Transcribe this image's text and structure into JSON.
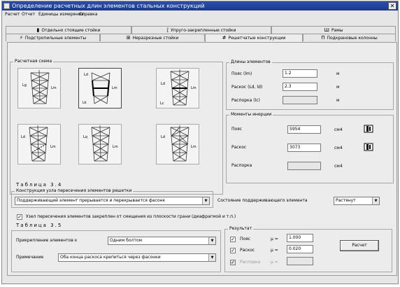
{
  "window": {
    "title": "Определение расчетных длин элементов стальных конструкций",
    "close_label": "✕"
  },
  "menu": [
    "Расчет",
    "Отчет",
    "Единицы измерения",
    "Справка"
  ],
  "tabs_row1": [
    {
      "label": "Отдельно стоящие стойки",
      "icon": "column-icon"
    },
    {
      "label": "Упруго-закрепленные стойки",
      "icon": "spring-icon"
    },
    {
      "label": "Рамы",
      "icon": "frame-icon"
    }
  ],
  "tabs_row2": [
    {
      "label": "Подстропильные элементы",
      "icon": "truss-icon"
    },
    {
      "label": "Неразрезные стойки",
      "icon": "continuous-column-icon"
    },
    {
      "label": "Решетчатые конструкции",
      "icon": "lattice-icon",
      "active": true
    },
    {
      "label": "Подкрановые колонны",
      "icon": "crane-column-icon"
    }
  ],
  "scheme": {
    "group_label": "Расчетная схема",
    "thumb_labels": [
      [
        "Lg",
        "Lm"
      ],
      [
        "Ld",
        "Lm",
        "Lk"
      ],
      [
        "Ld",
        "Lm",
        "Lc"
      ],
      [
        "Ld",
        "Lm"
      ],
      [
        "Lq",
        "Lm"
      ],
      [
        "Ld",
        "Lm"
      ]
    ]
  },
  "lengths": {
    "group_label": "Длины элементов",
    "rows": [
      {
        "label": "Пояс (lm)",
        "value": "1.2",
        "unit": "м",
        "disabled": false
      },
      {
        "label": "Раскос (Ld, ld)",
        "value": "2.3",
        "unit": "м",
        "disabled": false
      },
      {
        "label": "Распорка (lc)",
        "value": "",
        "unit": "м",
        "disabled": true
      }
    ]
  },
  "inertia": {
    "group_label": "Моменты инерции",
    "rows": [
      {
        "label": "Пояс",
        "value": "5954",
        "unit": "см4",
        "disabled": false
      },
      {
        "label": "Раскос",
        "value": "3073",
        "unit": "см4",
        "disabled": false
      },
      {
        "label": "Распорка",
        "value": "",
        "unit": "см4",
        "disabled": true
      }
    ]
  },
  "table34": {
    "title": "Таблица 3.4",
    "group_label": "Конструкция узла пересечения элементов решетки",
    "node_value": "Поддерживающий элемент прерывается и перекрывается фасонк",
    "support_label": "Состояние поддерживающего элемента",
    "support_value": "Растянут",
    "checkbox_label": "Узел пересечения элементов закреплен от смещения из плоскости грани (диафрагмой и т.п.)",
    "checkbox_checked": true
  },
  "table35": {
    "title": "Таблица 3.5",
    "attach_label": "Прикрепление элементов к",
    "attach_value": "Одним болтом",
    "note_label": "Примечание",
    "note_value": "Оба конца раскоса крепиться через фасонки"
  },
  "result": {
    "group_label": "Результат",
    "rows": [
      {
        "label": "Пояс",
        "mu_label": "μ =",
        "value": "1.000",
        "checked": true,
        "disabled": false
      },
      {
        "label": "Раскос",
        "mu_label": "μ =",
        "value": "0.020",
        "checked": true,
        "disabled": false
      },
      {
        "label": "Распорка",
        "mu_label": "μ =",
        "value": "",
        "checked": false,
        "disabled": true
      }
    ],
    "button_label": "Расчет"
  }
}
